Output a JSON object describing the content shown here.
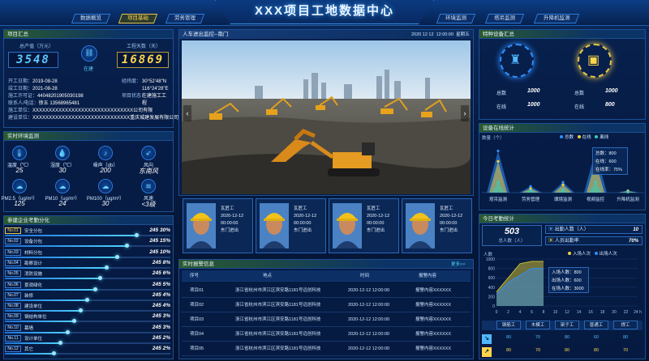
{
  "header": {
    "title": "XXX项目工地数据中心",
    "nav_left": [
      "数据概览",
      "项目基础",
      "劳务管理"
    ],
    "nav_right": [
      "环境监测",
      "塔吊监测",
      "升降机监测"
    ],
    "active_nav": "项目基础"
  },
  "project": {
    "panel_title": "项目汇总",
    "amount_label": "总产值（万元）",
    "amount_value": "3548",
    "center_label": "在建",
    "days_label": "工程天数（天）",
    "days_value": "16869",
    "info": [
      {
        "label": "开工日期：",
        "value": "2019-08-28",
        "label2": "经纬度：",
        "value2": "30°52'48\"N"
      },
      {
        "label": "竣工日期：",
        "value": "2021-08-28",
        "label2": "",
        "value2": "116°24'28\"E"
      },
      {
        "label": "施工许可证：",
        "value": "44048201905030198",
        "label2": "项目状态：",
        "value2": "在建施工工程"
      },
      {
        "label": "联系人/电话：",
        "value": "徐五   13568965481",
        "label2": "",
        "value2": ""
      }
    ],
    "construction_unit_label": "施工单位：",
    "construction_unit": "XXXXXXXXXXXXXXXXXXXXXXXXXXXXXXX公司有限",
    "build_unit_label": "建设单位：",
    "build_unit": "XXXXXXXXXXXXXXXXXXXXXXXXXXXXXX重庆城建发展有限公司"
  },
  "environment": {
    "panel_title": "实时环境监测",
    "items": [
      {
        "label": "温度（℃）",
        "value": "25",
        "icon": "thermometer-icon"
      },
      {
        "label": "湿度（℃）",
        "value": "30",
        "icon": "humidity-icon"
      },
      {
        "label": "噪声（db）",
        "value": "200",
        "icon": "noise-icon"
      },
      {
        "label": "风向",
        "value": "东南风",
        "icon": "wind-direction-icon"
      },
      {
        "label": "PM2.5（ug/m³）",
        "value": "125",
        "icon": "pm25-icon"
      },
      {
        "label": "PM10（ug/m³）",
        "value": "24",
        "icon": "pm10-icon"
      },
      {
        "label": "PM100（ug/m³）",
        "value": "30",
        "icon": "pm100-icon"
      },
      {
        "label": "风速",
        "value": "<3级",
        "icon": "wind-speed-icon"
      }
    ]
  },
  "ranking": {
    "panel_title": "参建企业考勤分化",
    "rows": [
      {
        "tag": "No.01",
        "name": "安全分包",
        "num": "245",
        "pct": "30%",
        "fill": 0.8
      },
      {
        "tag": "No.02",
        "name": "设备分包",
        "num": "245",
        "pct": "15%",
        "fill": 0.74
      },
      {
        "tag": "No.03",
        "name": "材料分包",
        "num": "245",
        "pct": "10%",
        "fill": 0.68
      },
      {
        "tag": "No.04",
        "name": "勘察设计",
        "num": "245",
        "pct": "8%",
        "fill": 0.62
      },
      {
        "tag": "No.05",
        "name": "消防设施",
        "num": "245",
        "pct": "6%",
        "fill": 0.58
      },
      {
        "tag": "No.06",
        "name": "景观绿化",
        "num": "245",
        "pct": "5%",
        "fill": 0.55
      },
      {
        "tag": "No.07",
        "name": "装修",
        "num": "245",
        "pct": "4%",
        "fill": 0.5
      },
      {
        "tag": "No.08",
        "name": "建设单位",
        "num": "245",
        "pct": "4%",
        "fill": 0.46
      },
      {
        "tag": "No.09",
        "name": "钢结构单位",
        "num": "245",
        "pct": "3%",
        "fill": 0.42
      },
      {
        "tag": "No.10",
        "name": "幕墙",
        "num": "245",
        "pct": "3%",
        "fill": 0.38
      },
      {
        "tag": "No.11",
        "name": "设计单位",
        "num": "245",
        "pct": "2%",
        "fill": 0.34
      },
      {
        "tag": "No.12",
        "name": "其它",
        "num": "245",
        "pct": "2%",
        "fill": 0.3
      }
    ]
  },
  "video": {
    "panel_title": "人车进出监控--南门",
    "date": "2020 12 12",
    "time": "12:00:00",
    "weekday": "星期五",
    "prev_icon": "chevron-left-icon",
    "next_icon": "chevron-right-icon"
  },
  "workers": [
    {
      "name": "瓦匠工",
      "date": "2020-12-12",
      "time": "00:00:00",
      "gate": "东门进出"
    },
    {
      "name": "瓦匠工",
      "date": "2020-12-12",
      "time": "00:00:00",
      "gate": "东门进出"
    },
    {
      "name": "瓦匠工",
      "date": "2020-12-12",
      "time": "00:00:00",
      "gate": "东门进出"
    },
    {
      "name": "瓦匠工",
      "date": "2020-12-12",
      "time": "00:00:00",
      "gate": "东门进出"
    }
  ],
  "alarms": {
    "panel_title": "实时报警信息",
    "more": "更多>>",
    "columns": [
      "序号",
      "地点",
      "时间",
      "报警内容"
    ],
    "rows": [
      {
        "id": "项目01",
        "place": "浙江省杭州市滨江区滨安路1181号远创科技",
        "time": "2020-12-12  12:00:00",
        "content": "报警内容XXXXXX"
      },
      {
        "id": "项目02",
        "place": "浙江省杭州市滨江区滨安路1181号远创科技",
        "time": "2020-12-12  12:00:00",
        "content": "报警内容XXXXXX"
      },
      {
        "id": "项目03",
        "place": "浙江省杭州市滨江区滨安路1181号远创科技",
        "time": "2020-12-12  12:00:00",
        "content": "报警内容XXXXXX"
      },
      {
        "id": "项目04",
        "place": "浙江省杭州市滨江区滨安路1181号远创科技",
        "time": "2020-12-12  12:00:00",
        "content": "报警内容XXXXXX"
      },
      {
        "id": "项目05",
        "place": "浙江省杭州市滨江区滨安路1181号远创科技",
        "time": "2020-12-12  12:00:00",
        "content": "报警内容XXXXXX"
      }
    ]
  },
  "equipment": {
    "panel_title": "特种设备汇总",
    "left": {
      "total_label": "总数",
      "total": "1000",
      "online_label": "在线",
      "online": "1000"
    },
    "right": {
      "total_label": "总数",
      "total": "1000",
      "online_label": "在线",
      "online": "800"
    }
  },
  "device_chart": {
    "panel_title": "设备在线统计",
    "unit": "数量（个）",
    "legend": [
      "总数",
      "在线",
      "离线"
    ],
    "tooltip": [
      "总数：800",
      "在线：600",
      "在线率：75%"
    ],
    "colors": {
      "total": "#2f8fff",
      "online": "#f0d040",
      "offline": "#30d0c0"
    }
  },
  "chart_data": [
    {
      "type": "area",
      "title": "设备在线统计",
      "ylabel": "数量（个）",
      "categories": [
        "塔吊监测",
        "劳务管理",
        "環境监测",
        "视频监控",
        "升降机监测"
      ],
      "series": [
        {
          "name": "总数",
          "values": [
            800,
            120,
            200,
            800,
            40
          ]
        },
        {
          "name": "在线",
          "values": [
            600,
            80,
            150,
            600,
            30
          ]
        },
        {
          "name": "离线",
          "values": [
            200,
            40,
            50,
            200,
            10
          ]
        }
      ],
      "tooltip": {
        "category": "環境监测",
        "总数": 800,
        "在线": 600,
        "在线率": "75%"
      }
    },
    {
      "type": "area",
      "title": "今日考勤统计",
      "ylabel": "人数",
      "xlabel": "h",
      "x": [
        0,
        2,
        4,
        6,
        8,
        10,
        12,
        14,
        16,
        18,
        20,
        22,
        24
      ],
      "ylim": [
        0,
        1000
      ],
      "series": [
        {
          "name": "入场人次",
          "values": [
            300,
            600,
            900,
            950,
            950
          ]
        },
        {
          "name": "出场人次",
          "values": [
            250,
            500,
            650,
            800,
            800
          ]
        }
      ],
      "tooltip": {
        "入场人数": 800,
        "出场人数": 600,
        "在场人数": 3000
      }
    }
  ],
  "attendance": {
    "panel_title": "今日考勤统计",
    "total": "503",
    "total_label": "总人数（人）",
    "in_label": "出勤人数（人）",
    "in_value": "10",
    "rate_label": "人员出勤率",
    "rate_value": "70%",
    "legend": [
      "入场人次",
      "出场人次"
    ],
    "y_unit": "人数",
    "y_ticks": [
      "1000",
      "800",
      "600",
      "400",
      "200",
      "0"
    ],
    "x_ticks": [
      "0",
      "2",
      "4",
      "6",
      "8",
      "10",
      "12",
      "14",
      "16",
      "18",
      "20",
      "22",
      "24 h"
    ],
    "tooltip": [
      "入场人数：800",
      "出场人数：600",
      "在场人数：3000"
    ]
  },
  "worktypes": {
    "headers": [
      "钢筋工",
      "木模工",
      "架子工",
      "普通工",
      "焊工"
    ],
    "in_row": [
      "80",
      "70",
      "80",
      "60",
      "80"
    ],
    "out_row": [
      "80",
      "70",
      "80",
      "80",
      "70"
    ]
  }
}
